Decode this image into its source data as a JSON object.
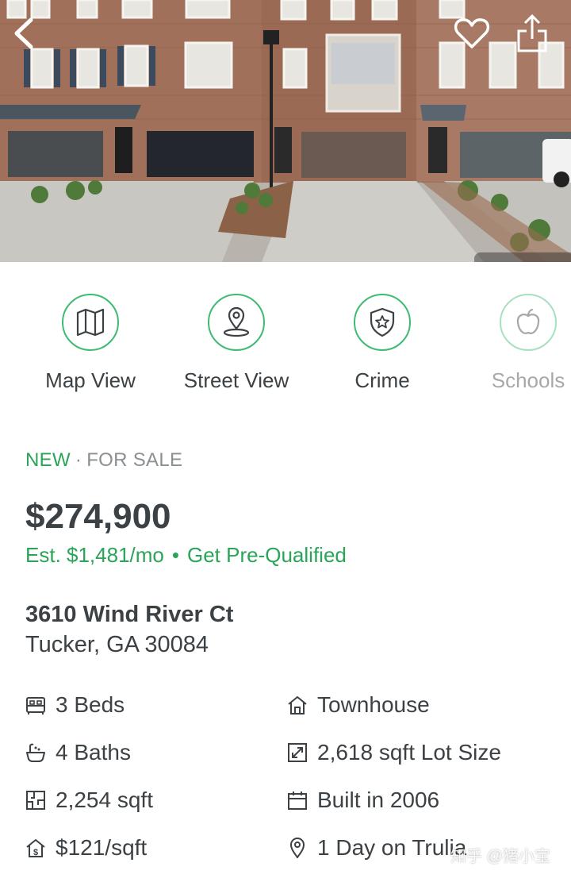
{
  "hero": {
    "icons": {
      "back": "chevron-left-icon",
      "favorite": "heart-icon",
      "share": "share-icon"
    }
  },
  "actions": [
    {
      "label": "Map View",
      "icon": "map-icon"
    },
    {
      "label": "Street View",
      "icon": "location-pin-icon"
    },
    {
      "label": "Crime",
      "icon": "shield-star-icon"
    },
    {
      "label": "Schools",
      "icon": "apple-icon"
    }
  ],
  "listing": {
    "status_new": "NEW",
    "status_separator": "·",
    "status_type": "FOR SALE",
    "price": "$274,900",
    "estimate": "Est. $1,481/mo",
    "estimate_separator": "•",
    "prequalify": "Get Pre-Qualified",
    "address_line1": "3610 Wind River Ct",
    "address_line2": "Tucker, GA 30084"
  },
  "facts": {
    "beds": "3 Beds",
    "property_type": "Townhouse",
    "baths": "4 Baths",
    "lot_size": "2,618 sqft Lot Size",
    "sqft": "2,254 sqft",
    "built": "Built in 2006",
    "price_per_sqft": "$121/sqft",
    "days_on": "1 Day on Trulia"
  },
  "watermark": "知乎 @猪小宝",
  "colors": {
    "accent_green": "#3dbb72",
    "text_green": "#2aa458",
    "text_dark": "#3b4144",
    "text_gray": "#8a8f92"
  }
}
